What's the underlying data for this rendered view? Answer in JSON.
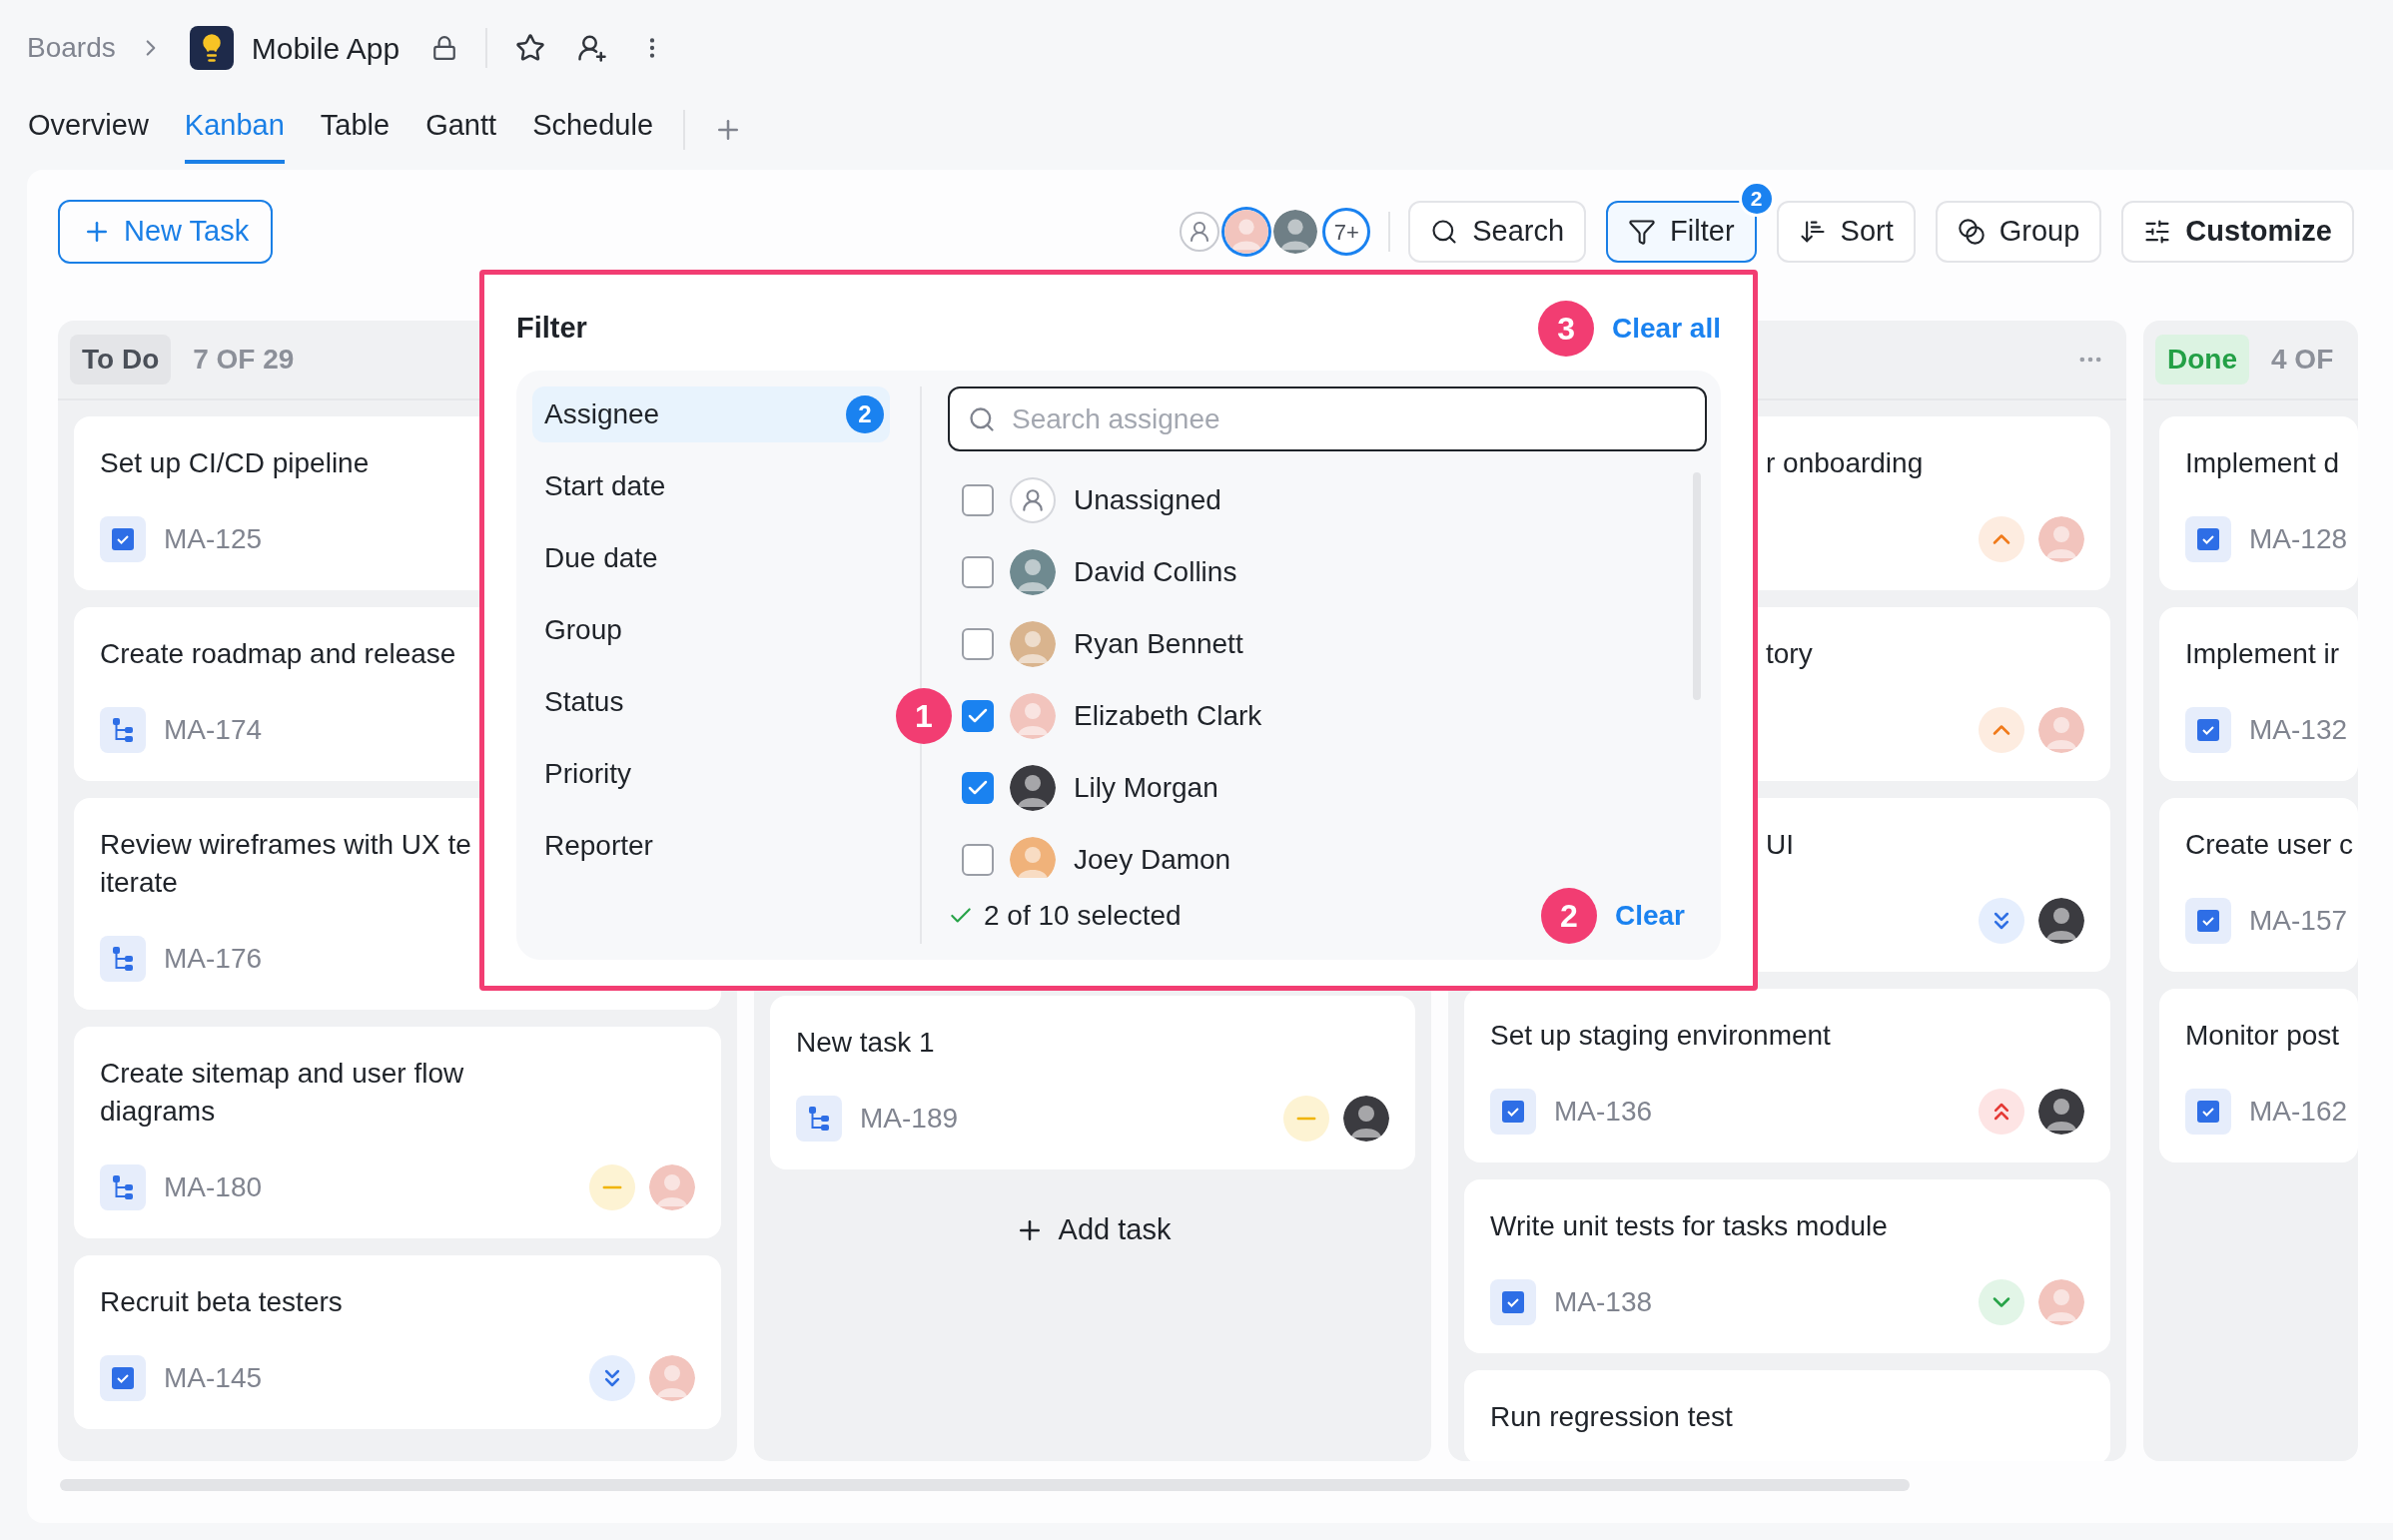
{
  "breadcrumb": {
    "root": "Boards",
    "board": "Mobile App"
  },
  "tabs": [
    {
      "label": "Overview",
      "selected": false
    },
    {
      "label": "Kanban",
      "selected": true
    },
    {
      "label": "Table",
      "selected": false
    },
    {
      "label": "Gantt",
      "selected": false
    },
    {
      "label": "Schedule",
      "selected": false
    }
  ],
  "toolbar": {
    "new_task": "New Task",
    "members": [
      {
        "color": "#f2c4bd",
        "selected": true
      },
      {
        "color": "#6f7f86",
        "selected": false
      }
    ],
    "more_members": "7+",
    "buttons": [
      {
        "kind": "search",
        "label": "Search"
      },
      {
        "kind": "filter",
        "label": "Filter",
        "badge": "2",
        "active": true
      },
      {
        "kind": "sort",
        "label": "Sort"
      },
      {
        "kind": "group",
        "label": "Group"
      },
      {
        "kind": "customize",
        "label": "Customize"
      }
    ]
  },
  "columns": [
    {
      "title": "To Do",
      "kind": "todo",
      "count": "7 OF 29",
      "cards": [
        {
          "title": "Set up CI/CD pipeline",
          "kind": "task",
          "id": "MA-125"
        },
        {
          "title": "Create roadmap and release",
          "kind": "subtask",
          "id": "MA-174"
        },
        {
          "title": "Review wireframes with UX te\niterate",
          "kind": "subtask",
          "id": "MA-176"
        },
        {
          "title": "Create sitemap and user flow\ndiagrams",
          "kind": "subtask",
          "id": "MA-180",
          "priority": {
            "kind": "medium"
          },
          "avatar": {
            "color": "#f2c4bd"
          }
        },
        {
          "title": "Recruit beta testers",
          "kind": "task",
          "id": "MA-145",
          "priority": {
            "kind": "lowest"
          },
          "avatar": {
            "color": "#f2c4bd"
          }
        }
      ]
    },
    {
      "add_task": "Add task",
      "cards": [
        {
          "title": "New task 1",
          "kind": "subtask",
          "id": "MA-189",
          "priority": {
            "kind": "medium"
          },
          "avatar": {
            "color": "#3b3b40"
          }
        }
      ]
    },
    {
      "has_menu": true,
      "cards": [
        {
          "title": "r onboarding",
          "priority": {
            "kind": "high"
          },
          "avatar": {
            "color": "#f2c4bd"
          }
        },
        {
          "title": "tory",
          "priority": {
            "kind": "high"
          },
          "avatar": {
            "color": "#f2c4bd"
          }
        },
        {
          "title": "UI",
          "priority": {
            "kind": "lowest"
          },
          "avatar": {
            "color": "#3b3b40"
          }
        },
        {
          "title": "Set up staging environment",
          "kind": "task",
          "id": "MA-136",
          "priority": {
            "kind": "highest"
          },
          "avatar": {
            "color": "#3b3b40"
          }
        },
        {
          "title": "Write unit tests for tasks module",
          "kind": "task",
          "id": "MA-138",
          "priority": {
            "kind": "low"
          },
          "avatar": {
            "color": "#f2c4bd"
          }
        },
        {
          "title": "Run regression test"
        }
      ]
    },
    {
      "title": "Done",
      "kind": "done",
      "count": "4 OF",
      "cards": [
        {
          "title": "Implement d",
          "kind": "task",
          "id": "MA-128"
        },
        {
          "title": "Implement ir",
          "kind": "task",
          "id": "MA-132"
        },
        {
          "title": "Create user c",
          "kind": "task",
          "id": "MA-157"
        },
        {
          "title": "Monitor post",
          "kind": "task",
          "id": "MA-162"
        }
      ]
    }
  ],
  "filter": {
    "title": "Filter",
    "clear_all": "Clear all",
    "clear_all_marker": "3",
    "categories": [
      {
        "label": "Assignee",
        "selected": true,
        "badge": "2"
      },
      {
        "label": "Start date",
        "selected": false
      },
      {
        "label": "Due date",
        "selected": false
      },
      {
        "label": "Group",
        "selected": false
      },
      {
        "label": "Status",
        "selected": false
      },
      {
        "label": "Priority",
        "selected": false
      },
      {
        "label": "Reporter",
        "selected": false
      }
    ],
    "search_placeholder": "Search assignee",
    "options": [
      {
        "name": "Unassigned",
        "kind": "unassigned",
        "checked": false
      },
      {
        "name": "David Collins",
        "kind": "person",
        "color": "#6f8a90",
        "checked": false
      },
      {
        "name": "Ryan Bennett",
        "kind": "person",
        "color": "#d9b48e",
        "checked": false
      },
      {
        "name": "Elizabeth Clark",
        "kind": "person",
        "color": "#f2c4bd",
        "checked": true,
        "marker": "1"
      },
      {
        "name": "Lily Morgan",
        "kind": "person",
        "color": "#3b3b40",
        "checked": true
      },
      {
        "name": "Joey Damon",
        "kind": "person",
        "color": "#f0b27a",
        "checked": false
      }
    ],
    "summary": "2 of 10 selected",
    "clear": "Clear",
    "clear_marker": "2"
  }
}
